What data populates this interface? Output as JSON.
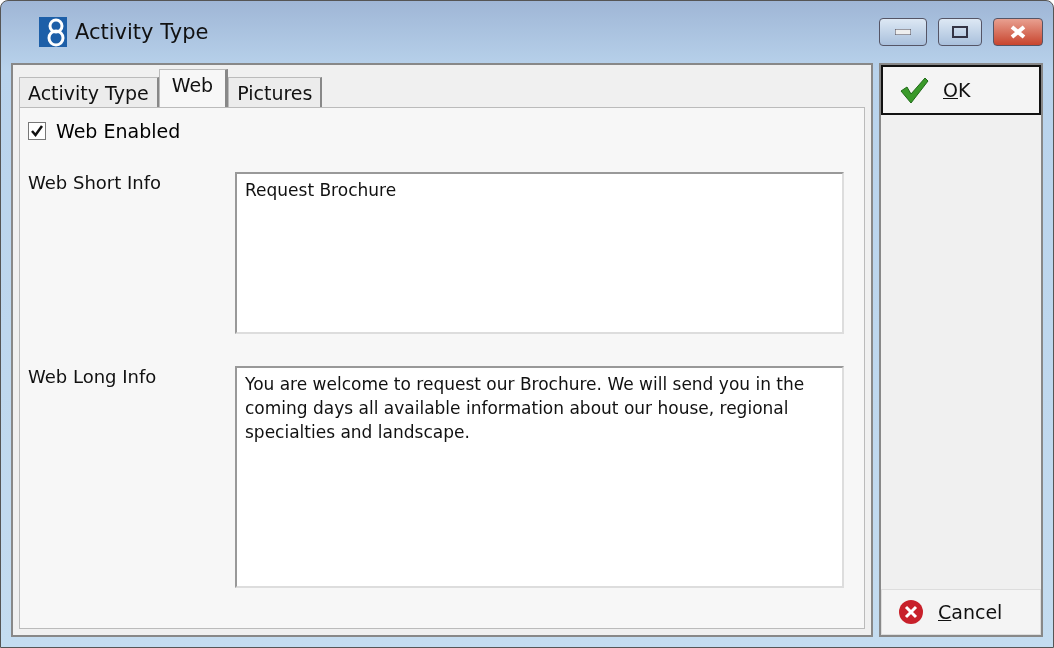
{
  "window": {
    "title": "Activity Type"
  },
  "tabs": [
    {
      "label": "Activity Type",
      "selected": false
    },
    {
      "label": "Web",
      "selected": true
    },
    {
      "label": "Pictures",
      "selected": false
    }
  ],
  "web_enabled": {
    "label": "Web Enabled",
    "checked": true
  },
  "fields": [
    {
      "label": "Web Short Info",
      "value": "Request Brochure"
    },
    {
      "label": "Web Long Info",
      "value": "You are welcome to request our Brochure. We will send you in the coming days all available information about our house, regional specialties and landscape."
    }
  ],
  "buttons": [
    {
      "label": "OK",
      "kind": "ok"
    },
    {
      "label": "Cancel",
      "kind": "cancel"
    }
  ]
}
